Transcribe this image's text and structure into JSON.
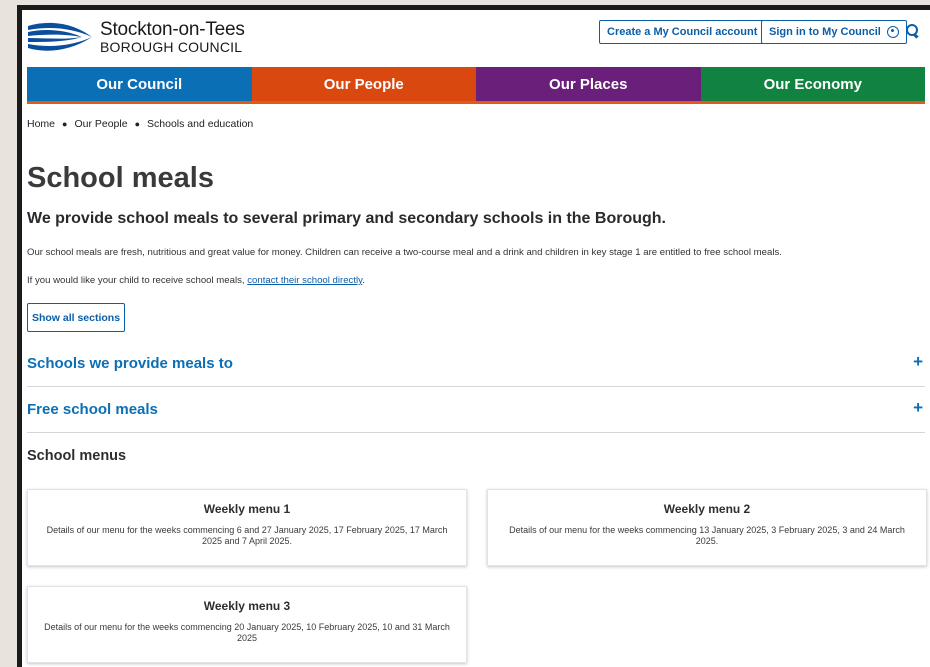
{
  "header": {
    "logo_name": "Stockton-on-Tees",
    "logo_sub": "BOROUGH COUNCIL",
    "create_account": "Create a My Council account",
    "sign_in": "Sign in to My Council"
  },
  "nav": {
    "items": [
      {
        "label": "Our Council",
        "color": "#0b6fb5"
      },
      {
        "label": "Our People",
        "color": "#d9480f"
      },
      {
        "label": "Our Places",
        "color": "#6a1f7a"
      },
      {
        "label": "Our Economy",
        "color": "#128241"
      }
    ]
  },
  "breadcrumb": [
    "Home",
    "Our People",
    "Schools and education"
  ],
  "page": {
    "title": "School meals",
    "lead": "We provide school meals to several primary and secondary schools in the Borough.",
    "p1": "Our school meals are fresh, nutritious and great value for money. Children can receive a two-course meal and a drink and children in key stage 1 are entitled to free school meals.",
    "p2_prefix": "If you would like your child to receive school meals, ",
    "p2_link": "contact their school directly",
    "p2_suffix": ".",
    "show_all": "Show all sections"
  },
  "accordion": [
    {
      "title": "Schools we provide meals to"
    },
    {
      "title": "Free school meals"
    }
  ],
  "menus": {
    "heading": "School menus",
    "cards": [
      {
        "title": "Weekly menu 1",
        "desc": "Details of our menu for the weeks commencing 6 and 27 January 2025, 17 February 2025, 17 March 2025 and 7 April 2025."
      },
      {
        "title": "Weekly menu 2",
        "desc": "Details of our menu for the weeks commencing 13 January 2025, 3 February 2025, 3 and 24 March 2025."
      },
      {
        "title": "Weekly menu 3",
        "desc": "Details of our menu for the weeks commencing 20 January 2025, 10 February 2025, 10 and 31 March 2025"
      }
    ]
  },
  "colors": {
    "link": "#0b5ea8",
    "accent_bar": "#e05a1a"
  }
}
